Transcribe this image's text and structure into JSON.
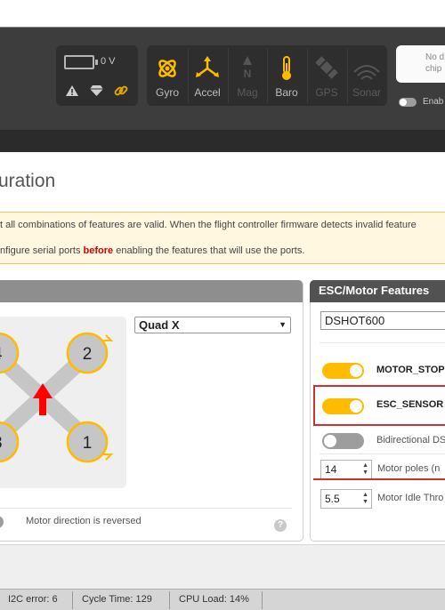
{
  "header": {
    "voltage": "0 V",
    "sensors": [
      {
        "label": "Gyro",
        "icon": "gyro-icon",
        "active": true
      },
      {
        "label": "Accel",
        "icon": "accel-icon",
        "active": true
      },
      {
        "label": "Mag",
        "icon": "mag-icon",
        "active": false
      },
      {
        "label": "Baro",
        "icon": "baro-icon",
        "active": true
      },
      {
        "label": "GPS",
        "icon": "gps-icon",
        "active": false
      },
      {
        "label": "Sonar",
        "icon": "sonar-icon",
        "active": false
      }
    ],
    "nodata_line1": "No d",
    "nodata_line2": "chip",
    "enable_label": "Enab",
    "accent": "#ffbb00"
  },
  "page": {
    "title": "uration",
    "warning_line1": "t all combinations of features are valid. When the flight controller firmware detects invalid feature",
    "warning_line2_pre": "nfigure serial ports ",
    "warning_line2_bold": "before",
    "warning_line2_post": " enabling the features that will use the ports."
  },
  "mixer": {
    "selected": "Quad X",
    "motor_labels": [
      "4",
      "2",
      "3",
      "1"
    ],
    "reversed_label": "Motor direction is reversed",
    "help": "?"
  },
  "esc": {
    "title": "ESC/Motor Features",
    "protocol": "DSHOT600",
    "motor_stop_label": "MOTOR_STOP",
    "motor_stop_on": true,
    "esc_sensor_label": "ESC_SENSOR",
    "esc_sensor_on": true,
    "bidir_label": "Bidirectional DS",
    "bidir_on": false,
    "motor_poles_value": "14",
    "motor_poles_label": "Motor poles (n",
    "idle_value": "5.5",
    "idle_label": "Motor Idle Thro",
    "highlight_color": "#d32f2f"
  },
  "status": {
    "i2c": "I2C error: 6",
    "cycle": "Cycle Time: 129",
    "cpu": "CPU Load: 14%"
  }
}
